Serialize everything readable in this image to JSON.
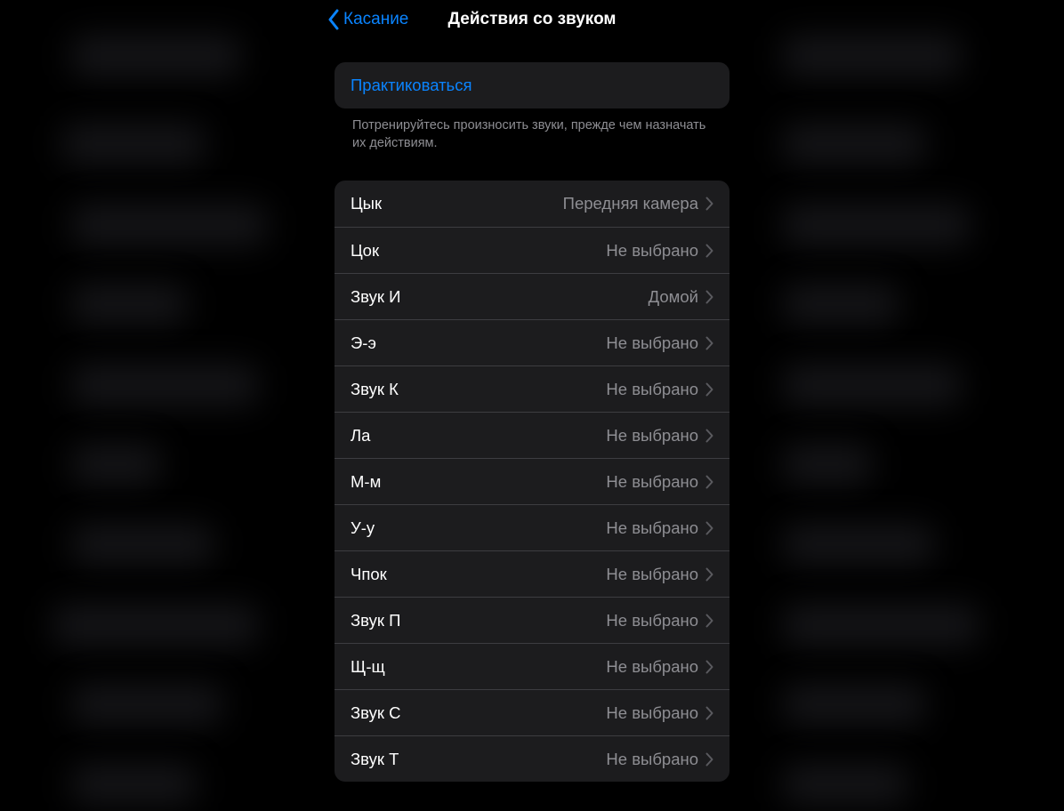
{
  "nav": {
    "back_label": "Касание",
    "title": "Действия со звуком"
  },
  "practice": {
    "label": "Практиковаться",
    "footer": "Потренируйтесь произносить звуки, прежде чем назначать их действиям."
  },
  "sounds": [
    {
      "name": "Цык",
      "value": "Передняя камера"
    },
    {
      "name": "Цок",
      "value": "Не выбрано"
    },
    {
      "name": "Звук И",
      "value": "Домой"
    },
    {
      "name": "Э-э",
      "value": "Не выбрано"
    },
    {
      "name": "Звук К",
      "value": "Не выбрано"
    },
    {
      "name": "Ла",
      "value": "Не выбрано"
    },
    {
      "name": "М-м",
      "value": "Не выбрано"
    },
    {
      "name": "У-у",
      "value": "Не выбрано"
    },
    {
      "name": "Чпок",
      "value": "Не выбрано"
    },
    {
      "name": "Звук П",
      "value": "Не выбрано"
    },
    {
      "name": "Щ-щ",
      "value": "Не выбрано"
    },
    {
      "name": "Звук С",
      "value": "Не выбрано"
    },
    {
      "name": "Звук Т",
      "value": "Не выбрано"
    }
  ]
}
